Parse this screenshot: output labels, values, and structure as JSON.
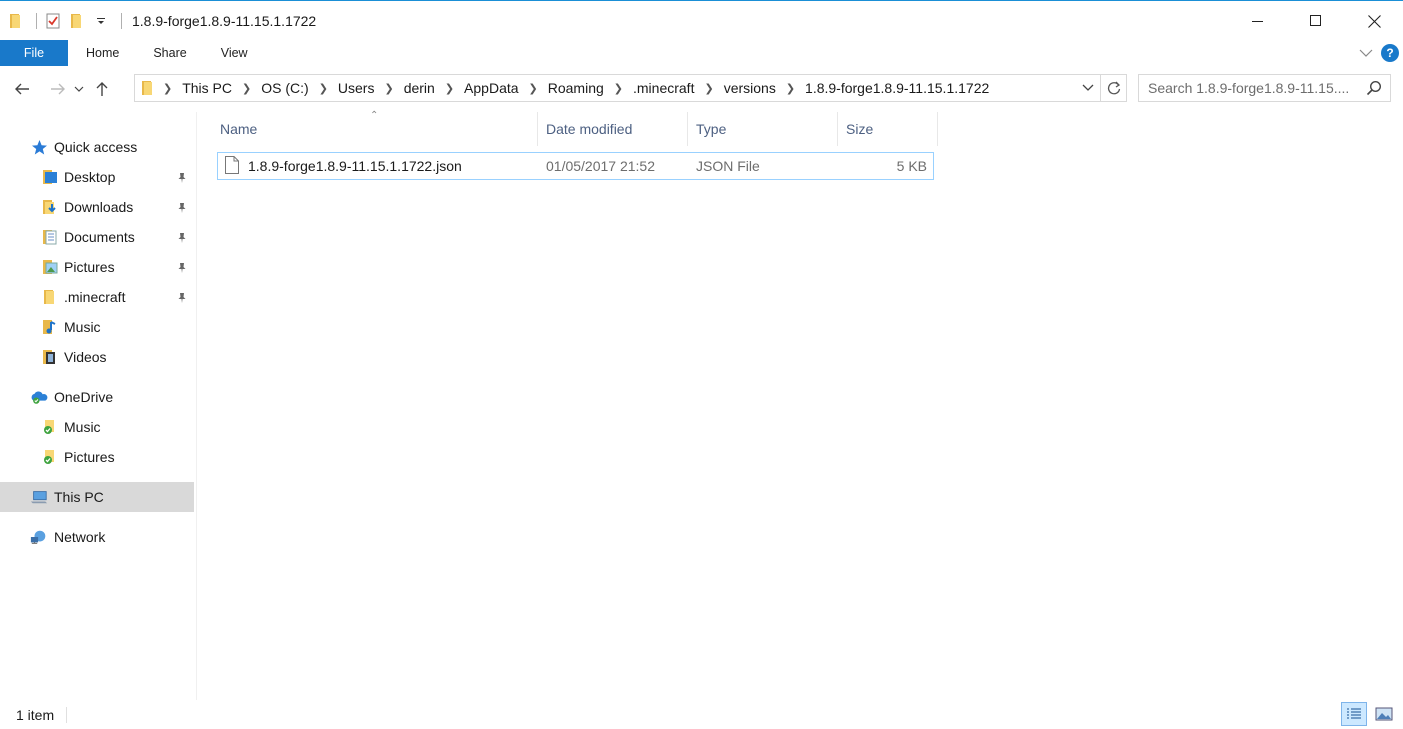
{
  "window": {
    "title": "1.8.9-forge1.8.9-11.15.1.1722"
  },
  "ribbon": {
    "tabs": [
      "File",
      "Home",
      "Share",
      "View"
    ],
    "help": "?"
  },
  "address": {
    "crumbs": [
      "This PC",
      "OS (C:)",
      "Users",
      "derin",
      "AppData",
      "Roaming",
      ".minecraft",
      "versions",
      "1.8.9-forge1.8.9-11.15.1.1722"
    ]
  },
  "search": {
    "placeholder": "Search 1.8.9-forge1.8.9-11.15...."
  },
  "navpane": {
    "quick_access": "Quick access",
    "quick_items": [
      "Desktop",
      "Downloads",
      "Documents",
      "Pictures",
      ".minecraft",
      "Music",
      "Videos"
    ],
    "onedrive": "OneDrive",
    "onedrive_items": [
      "Music",
      "Pictures"
    ],
    "this_pc": "This PC",
    "network": "Network"
  },
  "columns": {
    "name": "Name",
    "date": "Date modified",
    "type": "Type",
    "size": "Size"
  },
  "files": [
    {
      "name": "1.8.9-forge1.8.9-11.15.1.1722.json",
      "date": "01/05/2017 21:52",
      "type": "JSON File",
      "size": "5 KB"
    }
  ],
  "status": {
    "count": "1 item"
  },
  "colors": {
    "accent": "#1979ca",
    "selection_border": "#99d1ff",
    "folder": "#f8d775",
    "header_text": "#4d6082"
  }
}
